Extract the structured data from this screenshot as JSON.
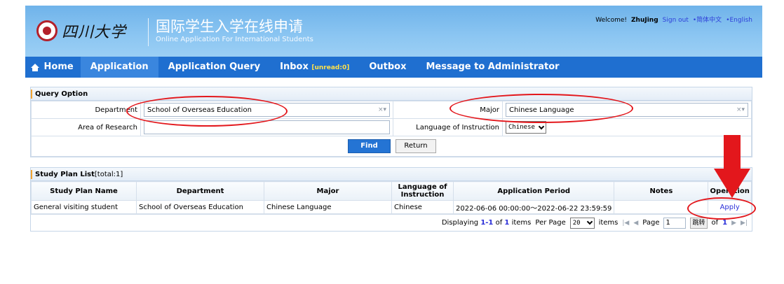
{
  "header": {
    "university_name": "四川大学",
    "system_title_cn": "国际学生入学在线申请",
    "system_title_en": "Online Application For International Students",
    "welcome_prefix": "Welcome!",
    "username": "ZhuJing",
    "sign_out": "Sign out",
    "lang_cn": "•简体中文",
    "lang_en": "•English"
  },
  "nav": {
    "home": "Home",
    "application": "Application",
    "application_query": "Application Query",
    "inbox": "Inbox",
    "unread": "[unread:0]",
    "outbox": "Outbox",
    "message_admin": "Message to Administrator"
  },
  "query": {
    "title": "Query Option",
    "department_label": "Department",
    "department_value": "School of Overseas Education",
    "major_label": "Major",
    "major_value": "Chinese Language",
    "research_label": "Area of Research",
    "research_value": "",
    "instruction_label": "Language of Instruction",
    "instruction_value": "Chinese",
    "find": "Find",
    "return": "Return",
    "clear_icon_text": "×▾"
  },
  "list": {
    "title": "Study Plan List",
    "total": "[total:1]",
    "columns": [
      "Study Plan Name",
      "Department",
      "Major",
      "Language of Instruction",
      "Application Period",
      "Notes",
      "Operation"
    ],
    "rows": [
      {
        "name": "General visiting student",
        "department": "School of Overseas Education",
        "major": "Chinese Language",
        "language": "Chinese",
        "period": "2022-06-06 00:00:00～2022-06-22 23:59:59",
        "notes": "",
        "action": "Apply"
      }
    ]
  },
  "pager": {
    "displaying": "Displaying",
    "range": "1-1",
    "of": "of",
    "count": "1",
    "items": "items",
    "per_page": "Per Page",
    "per_page_value": "20",
    "items2": "items",
    "page": "Page",
    "page_value": "1",
    "jump": "跳转",
    "of2": "of",
    "total_pages": "1"
  },
  "colors": {
    "nav_blue": "#1f6fd0",
    "annotation_red": "#e3171c",
    "link_blue": "#2b2fd8"
  }
}
